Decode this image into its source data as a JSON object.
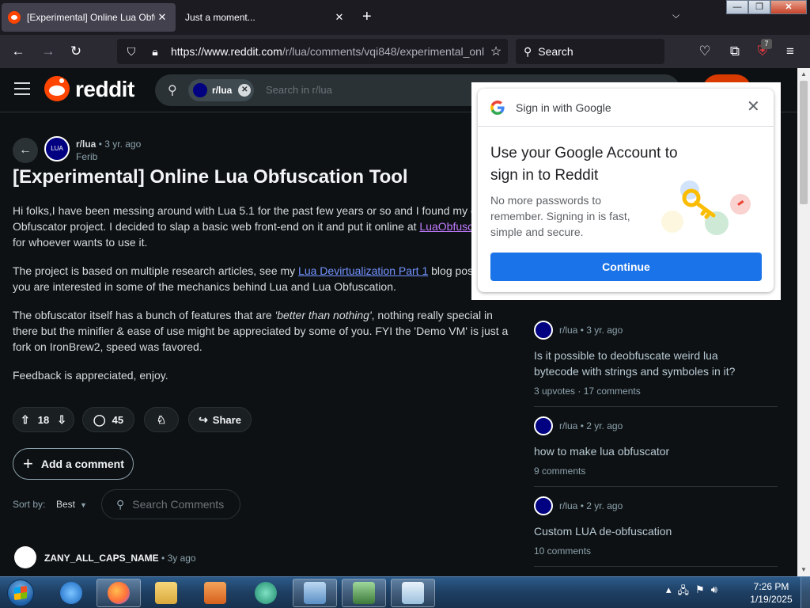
{
  "browser": {
    "tabs": [
      {
        "title": "[Experimental] Online Lua Obfus",
        "active": true
      },
      {
        "title": "Just a moment...",
        "active": false
      }
    ],
    "new_tab": "+",
    "tab_list": "⌄",
    "window_controls": {
      "minimize": "—",
      "maximize": "❐",
      "close": "✕"
    },
    "url_host": "https://www.reddit.com",
    "url_path": "/r/lua/comments/vqi848/experimental_onl",
    "search_placeholder": "Search",
    "extension_badge": "7"
  },
  "reddit": {
    "logo_text": "reddit",
    "search_chip": "r/lua",
    "search_placeholder": "Search in r/lua"
  },
  "post": {
    "subreddit": "r/lua",
    "subreddit_avatar_text": "LUA",
    "age": "• 3 yr. ago",
    "author": "Ferib",
    "title": "[Experimental] Online Lua Obfuscation Tool",
    "p1_a": "Hi folks,I have been messing around with Lua 5.1 for the past few years or so and I found my o",
    "p1_b": "Obfuscator project. I decided to slap a basic web front-end on it and put it online at ",
    "p1_link": "LuaObfusc",
    "p1_c": "for whoever wants to use it.",
    "p2_a": "The project is based on multiple research articles, see my ",
    "p2_link": "Lua Devirtualization Part 1",
    "p2_b": " blog post i",
    "p2_c": "you are interested in some of the mechanics behind Lua and Lua Obfuscation.",
    "p3_a": "The obfuscator itself has a bunch of features that are ",
    "p3_em": "'better than nothing'",
    "p3_b": ", nothing really special in",
    "p3_c": "there but the minifier & ease of use might be appreciated by some of you. FYI the 'Demo VM' is just a",
    "p3_d": "fork on IronBrew2, speed was favored.",
    "p4": "Feedback is appreciated, enjoy.",
    "votes": "18",
    "comments": "45",
    "share_label": "Share",
    "add_comment_label": "Add a comment",
    "sort_label": "Sort by:",
    "sort_value": "Best",
    "search_comments_placeholder": "Search Comments",
    "first_comment_author": "ZANY_ALL_CAPS_NAME",
    "first_comment_age": "• 3y ago"
  },
  "related": [
    {
      "sub": "r/lua",
      "age": "• 3 yr. ago",
      "title": "Is it possible to deobfuscate weird lua bytecode with strings and symboles in it?",
      "stats": "3 upvotes  ·  17 comments"
    },
    {
      "sub": "r/lua",
      "age": "• 2 yr. ago",
      "title": "how to make lua obfuscator",
      "stats": "9 comments"
    },
    {
      "sub": "r/lua",
      "age": "• 2 yr. ago",
      "title": "Custom LUA de-obfuscation",
      "stats": "10 comments"
    }
  ],
  "google_popup": {
    "header": "Sign in with Google",
    "heading": "Use your Google Account to sign in to Reddit",
    "body": "No more passwords to remember. Signing in is fast, simple and secure.",
    "button": "Continue"
  },
  "taskbar": {
    "time": "7:26 PM",
    "date": "1/19/2025"
  }
}
